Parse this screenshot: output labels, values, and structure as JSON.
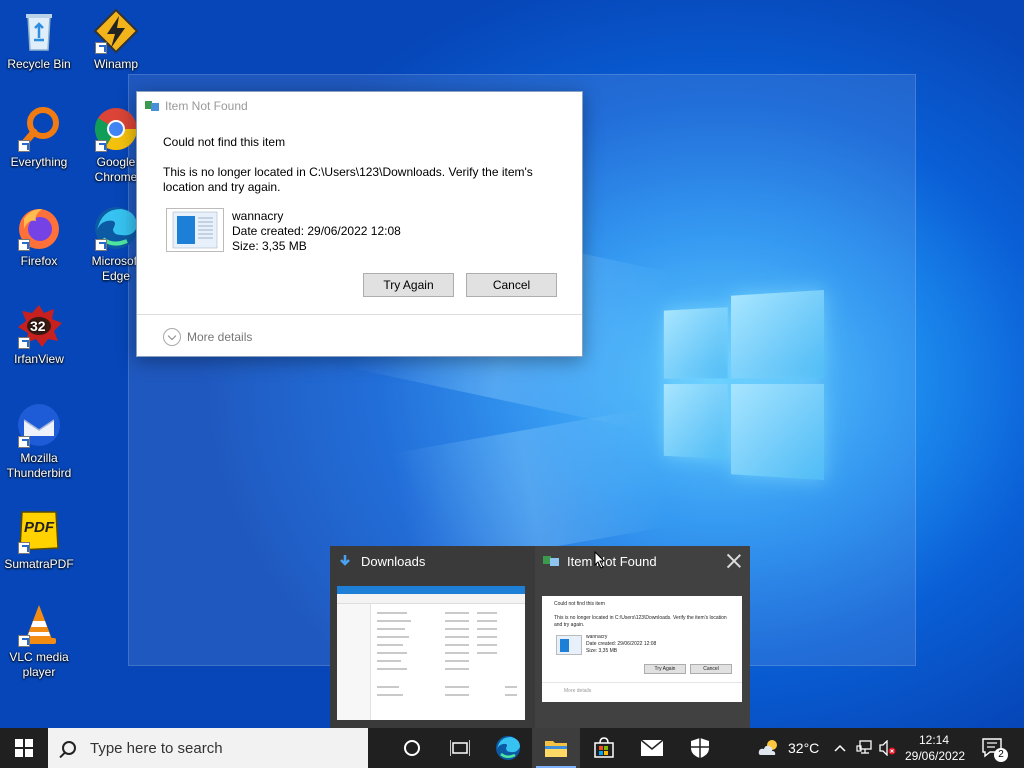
{
  "desktop_icons": [
    {
      "label": "Recycle Bin"
    },
    {
      "label": "Winamp"
    },
    {
      "label": "Everything"
    },
    {
      "label": "Google Chrome"
    },
    {
      "label": "Firefox"
    },
    {
      "label": "Microsoft Edge"
    },
    {
      "label": "IrfanView"
    },
    {
      "label": "Mozilla Thunderbird"
    },
    {
      "label": "SumatraPDF"
    },
    {
      "label": "VLC media player"
    }
  ],
  "irfanview_badge": "32",
  "sumatra_badge": "PDF",
  "dialog": {
    "title": "Item Not Found",
    "heading": "Could not find this item",
    "message": "This is no longer located in C:\\Users\\123\\Downloads. Verify the item's location and try again.",
    "file_name": "wannacry",
    "date_created": "Date created: 29/06/2022 12:08",
    "size": "Size: 3,35 MB",
    "try_again": "Try Again",
    "cancel": "Cancel",
    "more_details": "More details"
  },
  "thumbnails": {
    "downloads_title": "Downloads",
    "item_title": "Item Not Found",
    "mini_heading": "Could not find this item",
    "mini_message": "This is no longer located in C:\\Users\\123\\Downloads. Verify the item's location and try again.",
    "mini_file": "wannacry",
    "mini_date": "Date created: 29/06/2022 12:08",
    "mini_size": "Size: 3,35 MB",
    "mini_try": "Try Again",
    "mini_cancel": "Cancel",
    "mini_more": "More details"
  },
  "taskbar": {
    "search_placeholder": "Type here to search",
    "temperature": "32°C",
    "time": "12:14",
    "date": "29/06/2022",
    "notification_count": "2"
  },
  "colors": {
    "wallpaper": "#0a5fd6",
    "taskbar": "#202020",
    "accent": "#0078d7"
  }
}
